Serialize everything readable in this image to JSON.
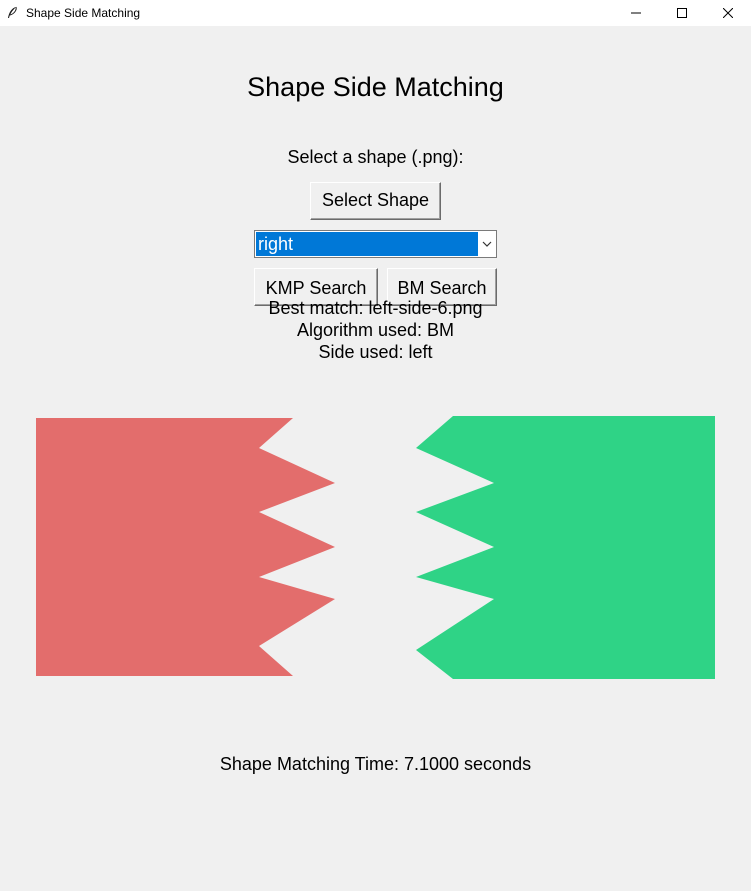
{
  "window": {
    "title": "Shape Side Matching",
    "icon": "feather-icon"
  },
  "main": {
    "heading": "Shape Side Matching",
    "select_label": "Select a shape (.png):",
    "select_button": "Select Shape",
    "side_select": {
      "value": "right"
    },
    "kmp_button": "KMP Search",
    "bm_button": "BM Search",
    "results": {
      "best_match": "Best match: left-side-6.png",
      "algorithm": "Algorithm used: BM",
      "side": "Side used: left"
    },
    "time_label": "Shape Matching Time: 7.1000 seconds"
  },
  "colors": {
    "selected_shape": "#e36d6c",
    "matched_shape": "#2fd386",
    "selection_highlight": "#0078d7",
    "background": "#f0f0f0"
  }
}
